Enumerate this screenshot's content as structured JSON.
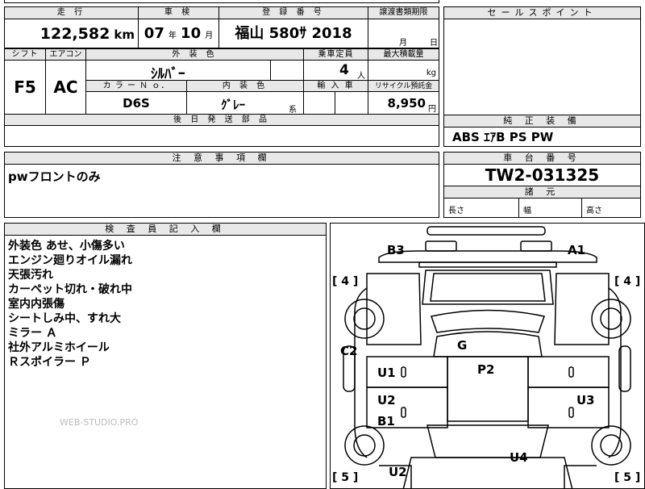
{
  "top": {
    "mileage_header": "走 行",
    "mileage_value": "122,582",
    "mileage_unit": "km",
    "inspection_header": "車 検",
    "inspection_year": "07",
    "inspection_year_unit": "年",
    "inspection_month": "10",
    "inspection_month_unit": "月",
    "registration_header": "登 録 番 号",
    "registration_value": "福山 580ｻ 2018",
    "transfer_header": "譲渡書類期限",
    "transfer_month_unit": "月",
    "transfer_day_unit": "日",
    "sales_point_header": "セールスポイント"
  },
  "spec": {
    "shift_header": "シフト",
    "shift_value": "F5",
    "ac_header": "エアコン",
    "ac_value": "AC",
    "exterior_header": "外 装 色",
    "exterior_value": "ｼﾙﾊﾞｰ",
    "capacity_header": "乗車定員",
    "capacity_value": "4",
    "capacity_unit": "人",
    "max_load_header": "最大積載量",
    "max_load_unit": "kg",
    "color_no_header": "カ ラ ー Ｎ ｏ．",
    "color_no_value": "D6S",
    "interior_header": "内 装 色",
    "interior_value": "ｸﾞﾚｰ",
    "interior_suffix": "系",
    "import_header": "輸 入 車",
    "recycle_header": "リサイクル預託金",
    "recycle_value": "8,950",
    "recycle_unit": "円",
    "later_parts_header": "後 日 発 送 部 品"
  },
  "equipment": {
    "header": "純 正 装 備",
    "value": "ABS ｴｱB PS PW"
  },
  "notes": {
    "header": "注 意 事 項 欄",
    "value": "pwフロントのみ"
  },
  "chassis": {
    "header": "車 台 番 号",
    "value": "TW2-031325",
    "dims_header": "諸 元",
    "length_label": "長さ",
    "width_label": "幅",
    "height_label": "高さ"
  },
  "inspector": {
    "header": "検 査 員 記 入 欄",
    "remarks": [
      "外装色 あせ、小傷多い",
      "エンジン廻りオイル漏れ",
      "天張汚れ",
      "カーペット切れ・破れ中",
      "室内内張傷",
      "シートしみ中、すれ大",
      "ミラー Ａ",
      "社外アルミホイール",
      "Ｒスポイラー Ｐ"
    ],
    "watermark": "WEB-STUDIO.PRO"
  },
  "diagram": {
    "labels": {
      "b3": "B3",
      "a1": "A1",
      "g": "G",
      "c2": "C2",
      "p2": "P2",
      "u1": "U1",
      "u2_left": "U2",
      "u3": "U3",
      "b1": "B1",
      "u4": "U4",
      "u2_bottom": "U2"
    },
    "tire_counts": {
      "front_left": "[ 4 ]",
      "front_right": "[ 4 ]",
      "rear_left": "[ 5 ]",
      "rear_right": "[ 5 ]"
    }
  }
}
